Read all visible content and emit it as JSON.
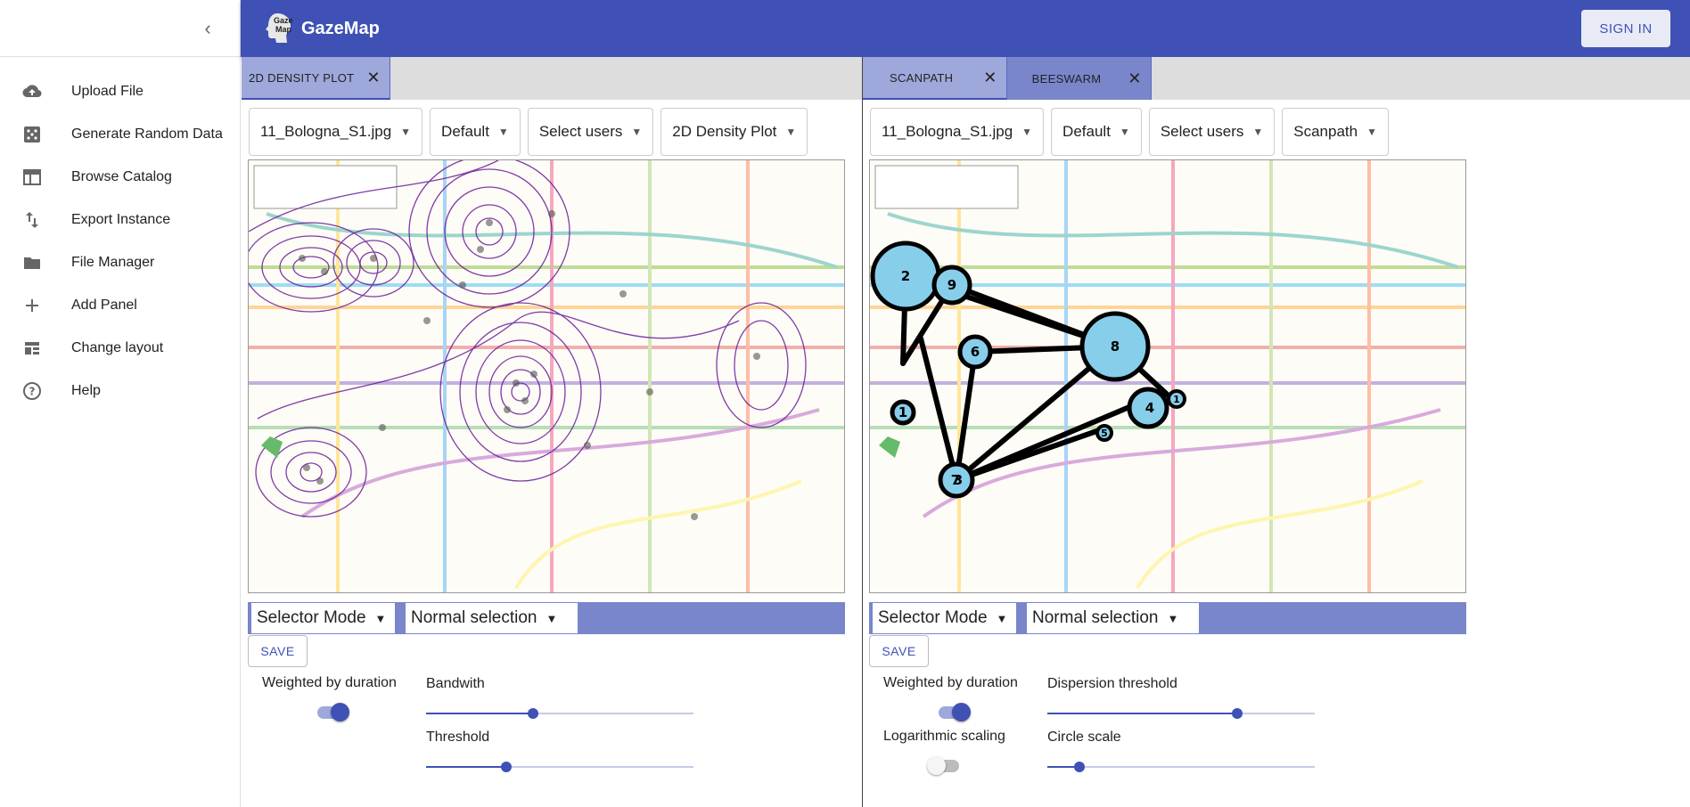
{
  "sidebar": {
    "items": [
      {
        "icon": "cloud-upload-icon",
        "label": "Upload File"
      },
      {
        "icon": "dice-icon",
        "label": "Generate Random Data"
      },
      {
        "icon": "catalog-icon",
        "label": "Browse Catalog"
      },
      {
        "icon": "export-icon",
        "label": "Export Instance"
      },
      {
        "icon": "folder-icon",
        "label": "File Manager"
      },
      {
        "icon": "plus-icon",
        "label": "Add Panel"
      },
      {
        "icon": "layout-icon",
        "label": "Change layout"
      },
      {
        "icon": "help-icon",
        "label": "Help"
      }
    ]
  },
  "appbar": {
    "title": "GazeMap",
    "logo_text_line1": "Gaze",
    "logo_text_line2": "Map",
    "signin": "SIGN IN",
    "color": "#3f51b5"
  },
  "left_panel": {
    "tabs": [
      {
        "label": "2D DENSITY PLOT"
      }
    ],
    "dropdowns": {
      "stimulus": "11_Bologna_S1.jpg",
      "color": "Default",
      "users": "Select users",
      "vis": "2D Density Plot"
    },
    "selector_mode": "Selector Mode",
    "selection": "Normal selection",
    "save": "SAVE",
    "weighted_label": "Weighted by duration",
    "weighted_on": true,
    "bandwidth_label": "Bandwith",
    "bandwidth_value": 0.4,
    "threshold_label": "Threshold",
    "threshold_value": 0.3
  },
  "right_panel": {
    "tabs": [
      {
        "label": "SCANPATH"
      },
      {
        "label": "BEESWARM"
      }
    ],
    "dropdowns": {
      "stimulus": "11_Bologna_S1.jpg",
      "color": "Default",
      "users": "Select users",
      "vis": "Scanpath"
    },
    "selector_mode": "Selector Mode",
    "selection": "Normal selection",
    "save": "SAVE",
    "weighted_label": "Weighted by duration",
    "weighted_on": true,
    "log_label": "Logarithmic scaling",
    "log_on": false,
    "dispersion_label": "Dispersion threshold",
    "dispersion_value": 0.71,
    "circle_label": "Circle scale",
    "circle_value": 0.12,
    "fixations": [
      {
        "label": "2"
      },
      {
        "label": "9"
      },
      {
        "label": "6"
      },
      {
        "label": "1"
      },
      {
        "label": "8"
      },
      {
        "label": "4"
      },
      {
        "label": "5"
      },
      {
        "label": "7"
      },
      {
        "label": "3"
      },
      {
        "label": "1"
      }
    ]
  },
  "colors": {
    "accent": "#3f51b5",
    "toolbar": "#7986cb",
    "fixation": "#87ceeb"
  }
}
